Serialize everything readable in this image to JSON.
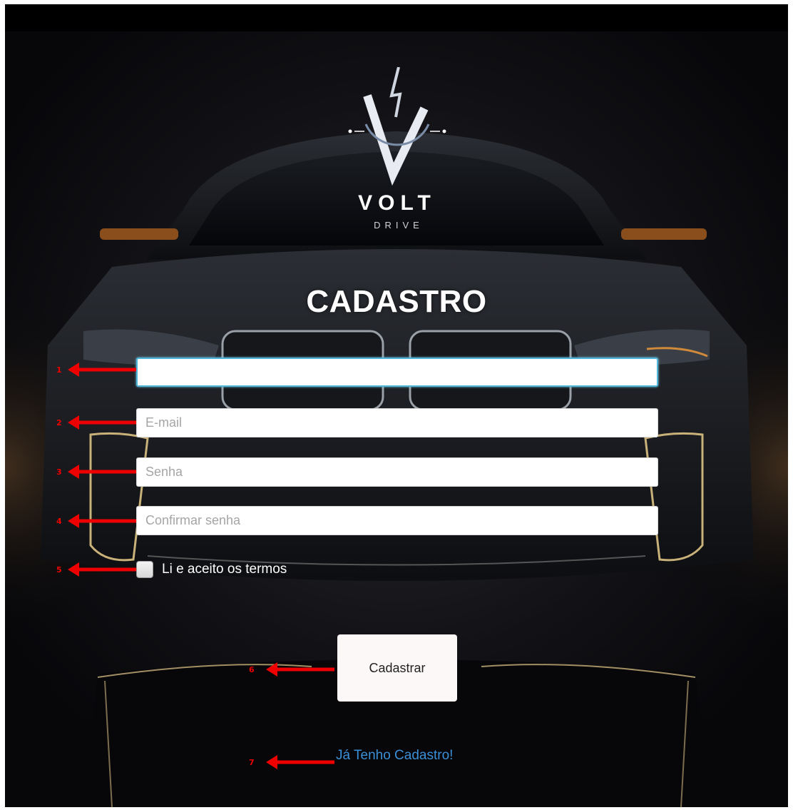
{
  "logo": {
    "brand": "VOLT",
    "subtitle": "DRIVE"
  },
  "form": {
    "title": "CADASTRO",
    "fields": [
      {
        "name": "name-field",
        "value": "",
        "placeholder": ""
      },
      {
        "name": "email-field",
        "value": "",
        "placeholder": "E-mail"
      },
      {
        "name": "password-field",
        "value": "",
        "placeholder": "Senha"
      },
      {
        "name": "confirm-password-field",
        "value": "",
        "placeholder": "Confirmar senha"
      }
    ],
    "terms_label": "Li e aceito os termos",
    "terms_checked": false,
    "submit_label": "Cadastrar",
    "login_link": "Já Tenho Cadastro!"
  },
  "annotations": [
    "1",
    "2",
    "3",
    "4",
    "5",
    "6",
    "7"
  ],
  "colors": {
    "background": "#0a0a0c",
    "focus_border": "#4fb6d9",
    "link": "#3b8fd6",
    "annotation": "#e00000"
  }
}
